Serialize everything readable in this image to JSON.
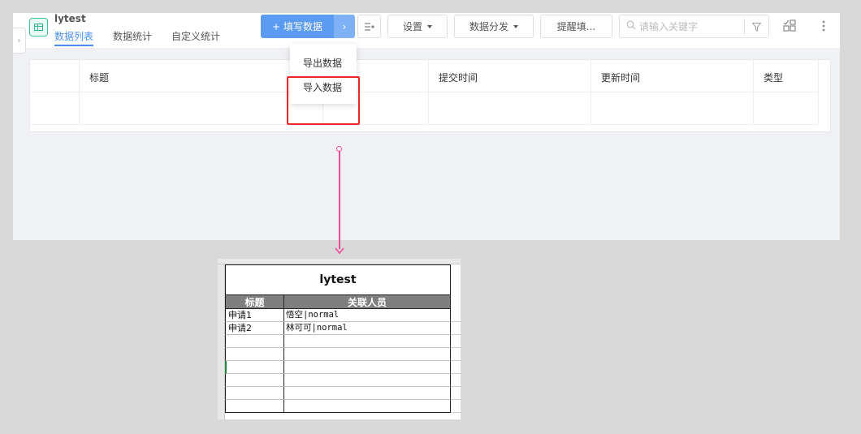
{
  "app": {
    "name": "lytest",
    "tabs": [
      {
        "label": "数据列表",
        "active": true
      },
      {
        "label": "数据统计",
        "active": false
      },
      {
        "label": "自定义统计",
        "active": false
      }
    ]
  },
  "toolbar": {
    "fill_data": "填写数据",
    "fill_plus": "+",
    "split_arrow": "›",
    "settings": "设置",
    "distribute": "数据分发",
    "remind": "提醒填...",
    "search_placeholder": "请输入关键字"
  },
  "dropdown": {
    "items": [
      "导出数据",
      "导入数据"
    ]
  },
  "table": {
    "columns": [
      "标题",
      "提交时间",
      "更新时间",
      "类型"
    ]
  },
  "sheet": {
    "title": "lytest",
    "headers": [
      "标题",
      "关联人员"
    ],
    "rows": [
      [
        "申请1",
        "悟空|normal"
      ],
      [
        "申请2",
        "林可可|normal"
      ],
      [
        "",
        ""
      ],
      [
        "",
        ""
      ],
      [
        "",
        ""
      ],
      [
        "",
        ""
      ],
      [
        "",
        ""
      ],
      [
        "",
        ""
      ]
    ]
  },
  "colors": {
    "primary": "#5b9bf2",
    "highlight": "#e8262b",
    "arrow": "#ee4b93"
  }
}
